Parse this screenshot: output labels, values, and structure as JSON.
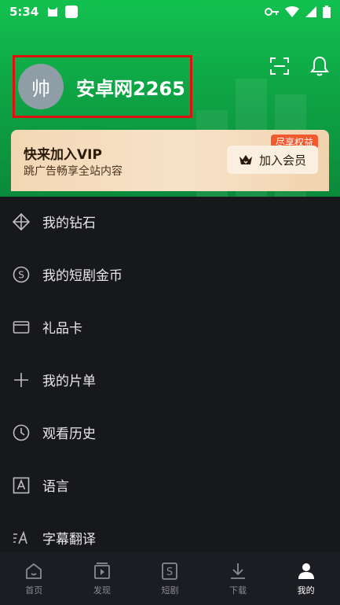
{
  "status_bar": {
    "time": "5:34"
  },
  "user": {
    "avatar_char": "帅",
    "name": "安卓网2265"
  },
  "vip": {
    "title": "快来加入VIP",
    "subtitle": "跳广告畅享全站内容",
    "tag": "尽享权益",
    "button_label": "加入会员"
  },
  "menu": {
    "items": [
      {
        "label": "我的钻石",
        "icon": "diamond-icon"
      },
      {
        "label": "我的短剧金币",
        "icon": "coin-icon"
      },
      {
        "label": "礼品卡",
        "icon": "card-icon"
      },
      {
        "label": "我的片单",
        "icon": "plus-icon"
      },
      {
        "label": "观看历史",
        "icon": "clock-icon"
      },
      {
        "label": "语言",
        "icon": "language-icon"
      },
      {
        "label": "字幕翻译",
        "icon": "subtitle-icon"
      }
    ]
  },
  "tabs": [
    {
      "label": "首页",
      "icon": "home-icon"
    },
    {
      "label": "发现",
      "icon": "discover-icon"
    },
    {
      "label": "短剧",
      "icon": "short-drama-icon"
    },
    {
      "label": "下载",
      "icon": "download-icon"
    },
    {
      "label": "我的",
      "icon": "profile-icon",
      "active": true
    }
  ],
  "colors": {
    "header_green": "#0ea545",
    "vip_tag": "#f25a2e",
    "highlight_box": "#e01010",
    "background": "#17181c"
  }
}
